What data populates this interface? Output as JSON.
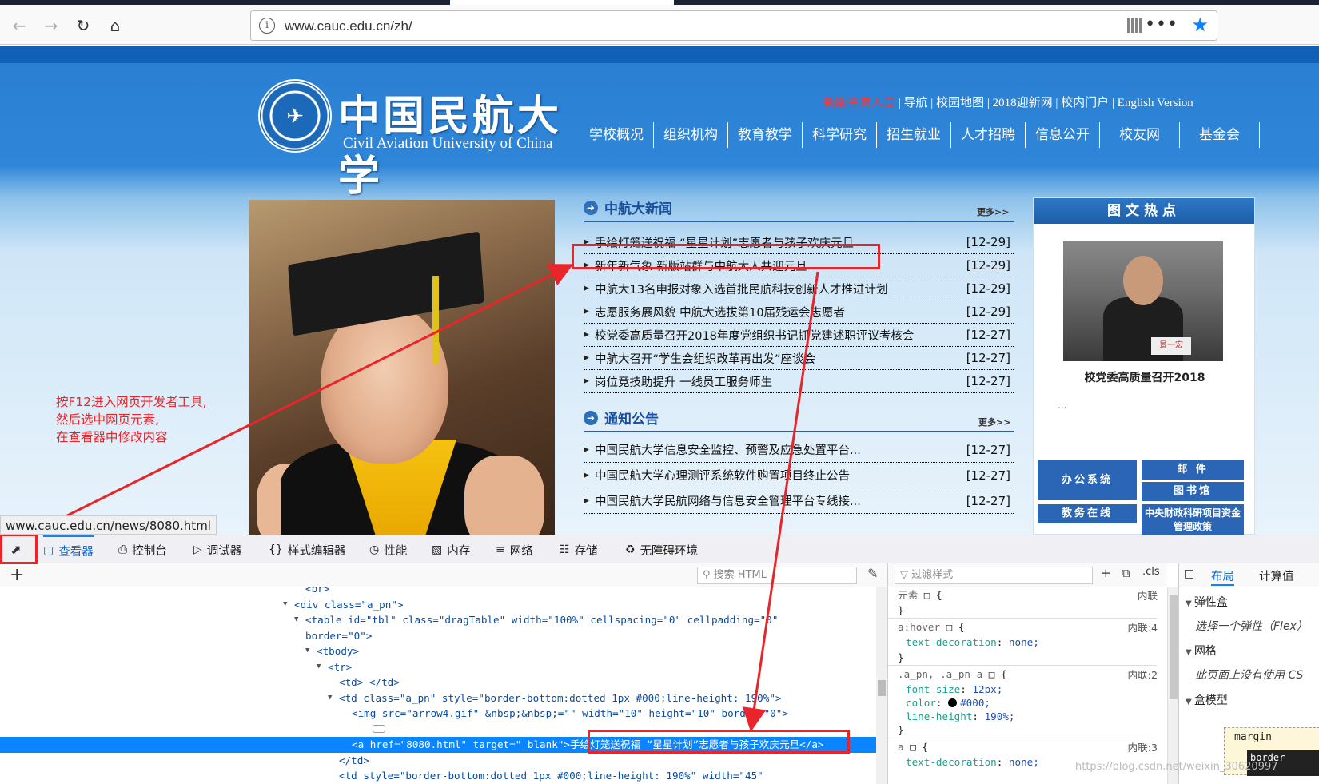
{
  "browser": {
    "url": "www.cauc.edu.cn/zh/",
    "status_url": "www.cauc.edu.cn/news/8080.html",
    "icons": [
      "back-icon",
      "forward-icon",
      "reload-icon",
      "home-icon",
      "info-icon",
      "qr-code-icon",
      "more-icon",
      "bookmark-star-icon"
    ],
    "accent": "#0a84ff"
  },
  "site": {
    "logo_cn": "中国民航大学",
    "logo_en": "Civil Aviation University of China",
    "top_links": [
      "新版主页入口",
      "导航",
      "校园地图",
      "2018迎新网",
      "校内门户",
      "English Version"
    ],
    "nav": [
      "学校概况",
      "组织机构",
      "教育教学",
      "科学研究",
      "招生就业",
      "人才招聘",
      "信息公开",
      "校友网",
      "基金会"
    ],
    "news": {
      "title": "中航大新闻",
      "more": "更多>>",
      "items": [
        {
          "title": "手绘灯笼送祝福 “星星计划”志愿者与孩子欢庆元旦",
          "date": "[12-29]"
        },
        {
          "title": "新年新气象 新版站群与中航大人共迎元旦",
          "date": "[12-29]"
        },
        {
          "title": "中航大13名申报对象入选首批民航科技创新人才推进计划",
          "date": "[12-29]"
        },
        {
          "title": "志愿服务展风貌 中航大选拔第10届残运会志愿者",
          "date": "[12-29]"
        },
        {
          "title": "校党委高质量召开2018年度党组织书记抓党建述职评议考核会",
          "date": "[12-27]"
        },
        {
          "title": "中航大召开“学生会组织改革再出发”座谈会",
          "date": "[12-27]"
        },
        {
          "title": "岗位竞技助提升 一线员工服务师生",
          "date": "[12-27]"
        }
      ]
    },
    "notice": {
      "title": "通知公告",
      "more": "更多>>",
      "items": [
        {
          "title": "中国民航大学信息安全监控、预警及应急处置平台...",
          "date": "[12-27]"
        },
        {
          "title": "中国民航大学心理测评系统软件购置项目终止公告",
          "date": "[12-27]"
        },
        {
          "title": "中国民航大学民航网络与信息安全管理平台专线接...",
          "date": "[12-27]"
        }
      ]
    },
    "hot": {
      "title": "图文热点",
      "caption": "校党委高质量召开2018",
      "ellipsis": "...",
      "name_plate": "景一宏",
      "blocks": [
        "办公系统",
        "邮 件",
        "图书馆",
        "教务在线",
        "中央财政科研项目资金管理政策"
      ]
    },
    "colors": {
      "brand_blue": "#1d6fc6",
      "highlight_red": "#ff3333"
    }
  },
  "devtools": {
    "tabs": [
      {
        "label": "查看器",
        "icon": "inspector-icon"
      },
      {
        "label": "控制台",
        "icon": "console-icon"
      },
      {
        "label": "调试器",
        "icon": "debugger-icon"
      },
      {
        "label": "样式编辑器",
        "icon": "style-editor-icon"
      },
      {
        "label": "性能",
        "icon": "performance-icon"
      },
      {
        "label": "内存",
        "icon": "memory-icon"
      },
      {
        "label": "网络",
        "icon": "network-icon"
      },
      {
        "label": "存储",
        "icon": "storage-icon"
      },
      {
        "label": "无障碍环境",
        "icon": "accessibility-icon"
      }
    ],
    "search_html_placeholder": "搜索 HTML",
    "filter_styles_placeholder": "过滤样式",
    "cls_label": ".cls",
    "layout_tabs": [
      "布局",
      "计算值"
    ],
    "layout_sections": [
      {
        "title": "弹性盒",
        "note": "选择一个弹性（Flex）"
      },
      {
        "title": "网格",
        "note": "此页面上没有使用 CS"
      },
      {
        "title": "盒模型",
        "note": ""
      }
    ],
    "box_model": {
      "margin": "margin",
      "border": "border"
    },
    "markup_lines": [
      "<br>",
      "<div class=\"a_pn\">",
      "<table id=\"tbl\" class=\"dragTable\" width=\"100%\" cellspacing=\"0\" cellpadding=\"0\"",
      "border=\"0\">",
      "<tbody>",
      "<tr>",
      "<td> </td>",
      "<td class=\"a_pn\" style=\"border-bottom:dotted 1px #000;line-height: 190%\">",
      "<img src=\"arrow4.gif\" &nbsp;&nbsp;=\"\" width=\"10\" height=\"10\" border=\"0\">",
      "",
      "<a href=\"8080.html\" target=\"_blank\">手绘灯笼送祝福 “星星计划”志愿者与孩子欢庆元旦</a>",
      "</td>",
      "<td style=\"border-bottom:dotted 1px #000;line-height: 190%\" width=\"45\""
    ],
    "rules": [
      {
        "selector": "元素",
        "brace": "{",
        "source": "内联",
        "close": "}"
      },
      {
        "selector": "a:hover",
        "brace": "{",
        "source": "内联:4",
        "prop": "text-decoration",
        "val": "none;",
        "close": "}"
      },
      {
        "selector": ".a_pn, .a_pn a",
        "brace": "{",
        "source": "内联:2",
        "props": [
          [
            "font-size",
            "12px;"
          ],
          [
            "color",
            "#000;"
          ],
          [
            "line-height",
            "190%;"
          ]
        ],
        "close": "}"
      },
      {
        "selector": "a",
        "brace": "{",
        "source": "内联:3",
        "prop": "text-decoration",
        "val": "none;",
        "close": "}"
      }
    ]
  },
  "annotation": {
    "note_lines": [
      "按F12进入网页开发者工具,",
      "然后选中网页元素,",
      "在查看器中修改内容"
    ],
    "color": "#e8252a"
  },
  "watermark": "https://blog.csdn.net/weixin_30620997"
}
